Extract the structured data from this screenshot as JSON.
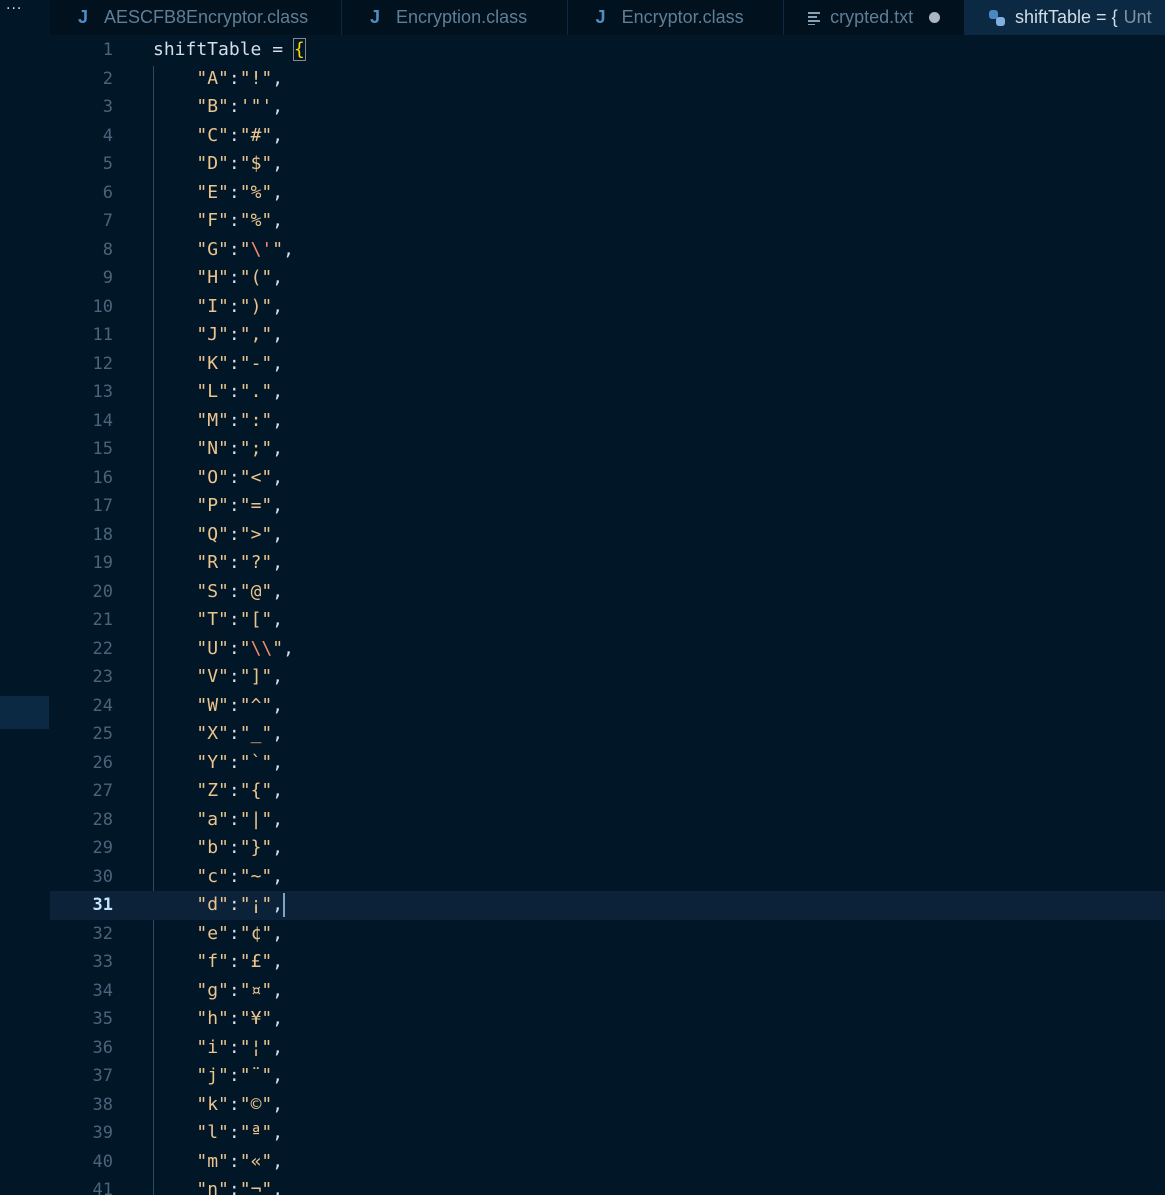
{
  "tabs": [
    {
      "icon": "J",
      "label": "AESCFB8Encryptor.class",
      "active": false
    },
    {
      "icon": "J",
      "label": "Encryption.class",
      "active": false
    },
    {
      "icon": "J",
      "label": "Encryptor.class",
      "active": false
    },
    {
      "icon": "lines",
      "label": "crypted.txt",
      "active": false,
      "modified": true
    },
    {
      "icon": "python",
      "label": "shiftTable = {",
      "suffix": "Unt",
      "active": true
    }
  ],
  "more_label": "···",
  "editor": {
    "first_line_text": "shiftTable = ",
    "open_brace": "{",
    "current_line": 31,
    "entries": [
      [
        "A",
        "!"
      ],
      [
        "B",
        "\""
      ],
      [
        "C",
        "#"
      ],
      [
        "D",
        "$"
      ],
      [
        "E",
        "%"
      ],
      [
        "F",
        "%"
      ],
      [
        "G",
        "\\'"
      ],
      [
        "H",
        "("
      ],
      [
        "I",
        ")"
      ],
      [
        "J",
        ","
      ],
      [
        "K",
        "-"
      ],
      [
        "L",
        "."
      ],
      [
        "M",
        ":"
      ],
      [
        "N",
        ";"
      ],
      [
        "O",
        "<"
      ],
      [
        "P",
        "="
      ],
      [
        "Q",
        ">"
      ],
      [
        "R",
        "?"
      ],
      [
        "S",
        "@"
      ],
      [
        "T",
        "["
      ],
      [
        "U",
        "\\\\"
      ],
      [
        "V",
        "]"
      ],
      [
        "W",
        "^"
      ],
      [
        "X",
        "_"
      ],
      [
        "Y",
        "`"
      ],
      [
        "Z",
        "{"
      ],
      [
        "a",
        "|"
      ],
      [
        "b",
        "}"
      ],
      [
        "c",
        "~"
      ],
      [
        "d",
        "¡"
      ],
      [
        "e",
        "¢"
      ],
      [
        "f",
        "£"
      ],
      [
        "g",
        "¤"
      ],
      [
        "h",
        "¥"
      ],
      [
        "i",
        "¦"
      ],
      [
        "j",
        "¨"
      ],
      [
        "k",
        "©"
      ],
      [
        "l",
        "ª"
      ],
      [
        "m",
        "«"
      ],
      [
        "n",
        "¬"
      ]
    ]
  },
  "colors": {
    "background": "#011627",
    "string": "#ecc48d",
    "escape": "#f78c6c",
    "brace": "#ffd700",
    "line_number": "#4b6479",
    "current_line_number": "#c5e4fd"
  }
}
